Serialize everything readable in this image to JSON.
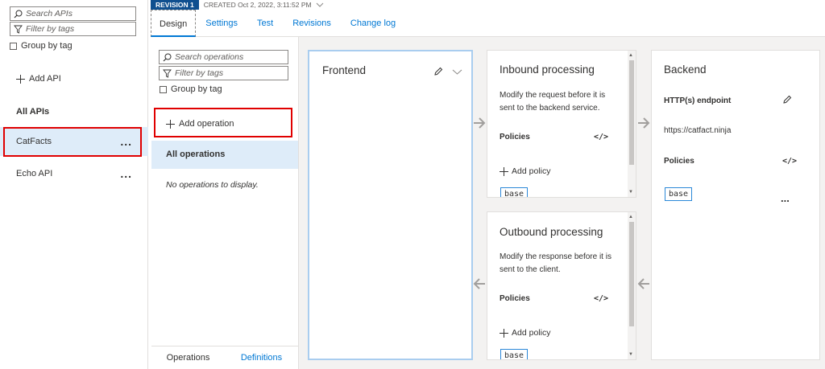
{
  "left_pane": {
    "search_placeholder": "Search APIs",
    "filter_placeholder": "Filter by tags",
    "group_by_tag": "Group by tag",
    "add_api": "Add API",
    "section_title": "All APIs",
    "apis": [
      {
        "label": "CatFacts",
        "selected": true
      },
      {
        "label": "Echo API",
        "selected": false
      }
    ],
    "more_glyph": "..."
  },
  "header": {
    "revision_badge": "REVISION 1",
    "created": "CREATED Oct 2, 2022, 3:11:52 PM",
    "tabs": [
      {
        "label": "Design",
        "active": true
      },
      {
        "label": "Settings"
      },
      {
        "label": "Test"
      },
      {
        "label": "Revisions"
      },
      {
        "label": "Change log"
      }
    ]
  },
  "operations": {
    "search_placeholder": "Search operations",
    "filter_placeholder": "Filter by tags",
    "group_by_tag": "Group by tag",
    "add_operation": "Add operation",
    "all_operations": "All operations",
    "empty_text": "No operations to display.",
    "bottom_tabs": [
      "Operations",
      "Definitions"
    ]
  },
  "design": {
    "frontend": {
      "title": "Frontend"
    },
    "inbound": {
      "title": "Inbound processing",
      "description": "Modify the request before it is sent to the backend service.",
      "policies_label": "Policies",
      "code_glyph": "</>",
      "add_policy": "Add policy",
      "base_tag": "base",
      "more_glyph": "..."
    },
    "outbound": {
      "title": "Outbound processing",
      "description": "Modify the response before it is sent to the client.",
      "policies_label": "Policies",
      "code_glyph": "</>",
      "add_policy": "Add policy",
      "base_tag": "base",
      "more_glyph": "..."
    },
    "backend": {
      "title": "Backend",
      "endpoint_label": "HTTP(s) endpoint",
      "endpoint_url": "https://catfact.ninja",
      "policies_label": "Policies",
      "code_glyph": "</>",
      "base_tag": "base",
      "more_glyph": "..."
    }
  },
  "colors": {
    "accent": "#0078d4",
    "selected_bg": "#deecf9",
    "highlight_red": "#e00000",
    "revision_badge_bg": "#0f4f8f"
  }
}
